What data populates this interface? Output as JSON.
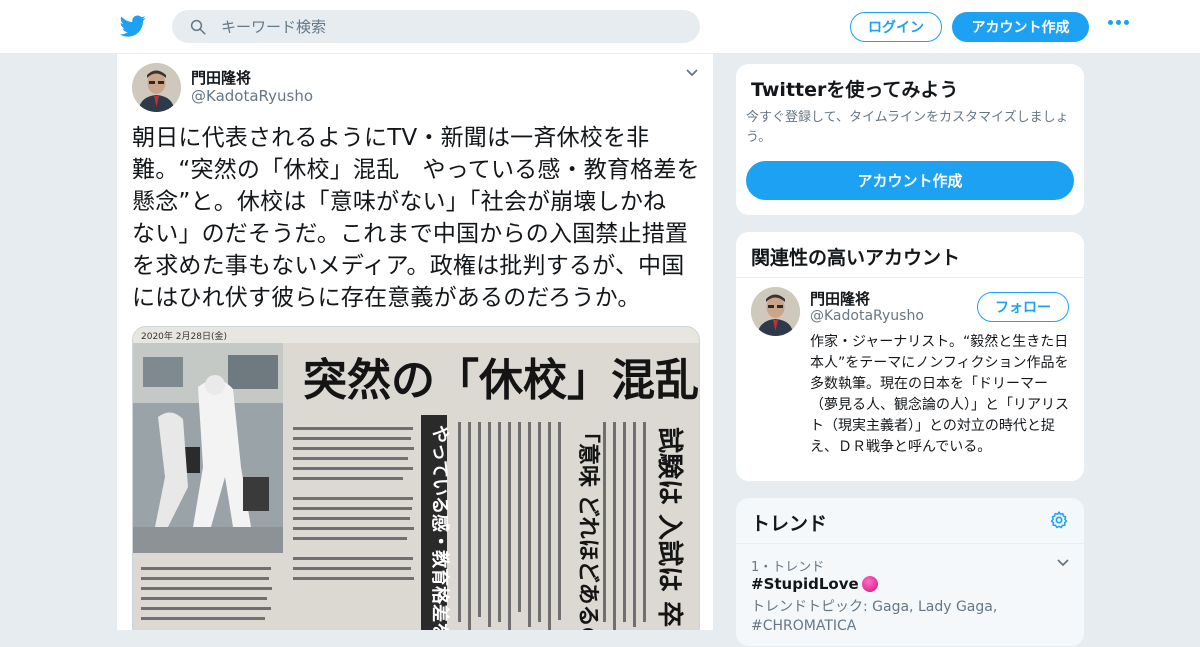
{
  "nav": {
    "search_placeholder": "キーワード検索",
    "login_label": "ログイン",
    "signup_label": "アカウント作成",
    "more_icon": "more-dots-icon",
    "brand_color": "#1da1f2"
  },
  "tweet": {
    "author_name": "門田隆将",
    "author_handle": "@KadotaRyusho",
    "text": "朝日に代表されるようにTV・新聞は一斉休校を非\n難。“突然の「休校」混乱　やっている感・教育格差を\n懸念”と。休校は「意味がない」「社会が崩壊しかね\nない」のだそうだ。これまで中国からの入国禁止措置\nを求めた事もないメディア。政権は批判するが、中国\nにはひれ伏す彼らに存在意義があるのだろうか。",
    "image": {
      "headline": "突然の「休校」混乱",
      "sub_left": "やっている感・教育格差を",
      "sub_mid": "「意味 どれほどあるのか",
      "sub_right": "試験は 入試は 卒",
      "date_line": "2020年 2月28日(金)"
    }
  },
  "sidebar": {
    "signup_card": {
      "title": "Twitterを使ってみよう",
      "description": "今すぐ登録して、タイムラインをカスタマイズしましょう。",
      "button_label": "アカウント作成"
    },
    "related_card": {
      "title": "関連性の高いアカウント",
      "account_name": "門田隆将",
      "account_handle": "@KadotaRyusho",
      "follow_label": "フォロー",
      "bio": "作家・ジャーナリスト。“毅然と生きた日本人”をテーマにノンフィクション作品を多数執筆。現在の日本を「ドリーマー（夢見る人、観念論の人）」と「リアリスト（現実主義者）」との対立の時代と捉え、ＤＲ戦争と呼んでいる。"
    },
    "trends_card": {
      "title": "トレンド",
      "items": [
        {
          "meta": "1・トレンド",
          "name": "#StupidLove",
          "topics": "トレンドトピック: Gaga, Lady Gaga, #CHROMATICA"
        }
      ]
    }
  }
}
